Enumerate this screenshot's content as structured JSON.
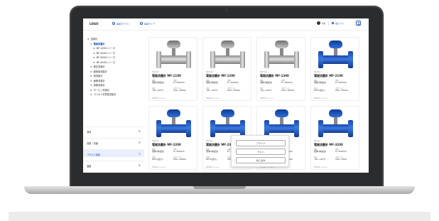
{
  "header": {
    "logo": "LOGO",
    "search_label": "製品カテゴリ",
    "category_label": "製品タイプ",
    "lang_label": "中文",
    "cart_label": "検討リスト"
  },
  "sidebar": {
    "tree": [
      {
        "label": "流量計",
        "level": 0,
        "active": false
      },
      {
        "label": "電磁流量計",
        "level": 1,
        "active": true
      },
      {
        "label": "MF-1000シリーズ",
        "level": 2,
        "active": false
      },
      {
        "label": "MF-2000シリーズ",
        "level": 2,
        "active": false
      },
      {
        "label": "MF-3000シリーズ",
        "level": 2,
        "active": false
      },
      {
        "label": "MF-4000シリーズ",
        "level": 2,
        "active": false
      },
      {
        "label": "差圧流量計",
        "level": 1,
        "active": false
      },
      {
        "label": "超音波流量計",
        "level": 1,
        "active": false
      },
      {
        "label": "渦流量計",
        "level": 1,
        "active": false
      },
      {
        "label": "面積流量計",
        "level": 1,
        "active": false
      },
      {
        "label": "容積流量計",
        "level": 1,
        "active": false
      },
      {
        "label": "タービン流量計",
        "level": 1,
        "active": false
      },
      {
        "label": "コリオリ式質量流量計",
        "level": 1,
        "active": false
      }
    ],
    "filters": [
      {
        "label": "流体",
        "expanded": false
      },
      {
        "label": "流量・流速",
        "expanded": false
      },
      {
        "label": "プロセス接続",
        "expanded": true
      },
      {
        "label": "温度",
        "expanded": false
      }
    ]
  },
  "popup": {
    "options": [
      "フランジ",
      "ウエハ",
      "ねじ込み"
    ]
  },
  "spec_labels": {
    "fluid": "流体",
    "flow": "流量",
    "temp": "温度",
    "size": "口径サイズ"
  },
  "products": [
    {
      "category": "電磁流量計",
      "name": "電磁流量計 MF-1100",
      "fluid": "液体(導電性)",
      "flow": "0~3000l/h",
      "temp": "-40~120℃",
      "size": "25A~1000A",
      "foot": "標準価格 ¥120,000 ~",
      "color": "silver"
    },
    {
      "category": "電磁流量計",
      "name": "電磁流量計 MF-1200",
      "fluid": "液体(導電性)",
      "flow": "0~3000l/h",
      "temp": "-40~120℃",
      "size": "25A~1000A",
      "foot": "標準価格 ¥120,000 ~",
      "color": "silver"
    },
    {
      "category": "電磁流量計",
      "name": "電磁流量計 MF-1300",
      "fluid": "液体(導電性)",
      "flow": "0~3000l/h",
      "temp": "-40~120℃",
      "size": "25A~1000A",
      "foot": "標準価格 ¥120,000 ~",
      "color": "silver"
    },
    {
      "category": "電磁流量計",
      "name": "電磁流量計 MF-2100",
      "fluid": "液体(導電性)",
      "flow": "0~3000l/h",
      "temp": "90℃(最大)",
      "size": "25A~1000A",
      "foot": "標準価格 ¥120,000 ~",
      "color": "blue"
    },
    {
      "category": "電磁流量計",
      "name": "電磁流量計 MF-2200",
      "fluid": "液体(導電性)",
      "flow": "0~3000l/h",
      "temp": "90℃(最大)",
      "size": "25A~1000A",
      "foot": "標準価格 ¥120,000 ~",
      "color": "blue"
    },
    {
      "category": "電磁流量計",
      "name": "電磁流量計 MF-2300",
      "fluid": "液体(導電性)",
      "flow": "0~3000l/h",
      "temp": "90℃(最大)",
      "size": "25A~1000A",
      "foot": "標準価格 ¥120,000 ~",
      "color": "blue"
    },
    {
      "category": "電磁流量計",
      "name": "電磁流量計 MF-3100",
      "fluid": "液体(導電性)",
      "flow": "0~3000l/h",
      "temp": "-40~120℃",
      "size": "10A~150A",
      "foot": "標準価格 ¥120,000 ~",
      "color": "blue"
    },
    {
      "category": "電磁流量計",
      "name": "電磁流量計 MF-3200",
      "fluid": "液体(導電性)",
      "flow": "0~3000l/h",
      "temp": "-40~120℃",
      "size": "10A~150A",
      "foot": "標準価格 ¥120,000 ~",
      "color": "blue"
    }
  ]
}
